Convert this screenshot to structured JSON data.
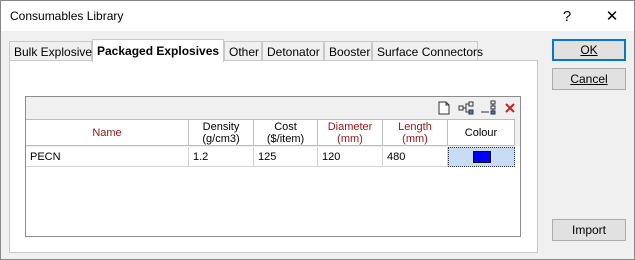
{
  "window": {
    "title": "Consumables Library",
    "help_glyph": "?",
    "close_glyph": "✕"
  },
  "tabs": [
    {
      "label": "Bulk Explosives",
      "active": false
    },
    {
      "label": "Packaged Explosives",
      "active": true
    },
    {
      "label": "Other",
      "active": false
    },
    {
      "label": "Detonator",
      "active": false
    },
    {
      "label": "Booster",
      "active": false
    },
    {
      "label": "Surface Connectors",
      "active": false
    }
  ],
  "grid": {
    "toolbar_icons": [
      "new-document-icon",
      "tree-structure-icon",
      "insert-row-icon",
      "delete-icon"
    ],
    "columns": [
      {
        "label": "Name",
        "highlight": true
      },
      {
        "label": "Density\n(g/cm3)",
        "highlight": false
      },
      {
        "label": "Cost\n($/item)",
        "highlight": false
      },
      {
        "label": "Diameter\n(mm)",
        "highlight": true
      },
      {
        "label": "Length\n(mm)",
        "highlight": true
      },
      {
        "label": "Colour",
        "highlight": false
      }
    ],
    "rows": [
      {
        "name": "PECN",
        "density": "1.2",
        "cost": "125",
        "diameter": "120",
        "length": "480",
        "colour": "#0000ff"
      }
    ]
  },
  "buttons": {
    "ok": "OK",
    "cancel": "Cancel",
    "import": "Import"
  },
  "colors": {
    "header_red": "#8b1a1a",
    "selected_cell": "#c7dcf5",
    "delete_red": "#cc2020",
    "default_border": "#0078d7"
  }
}
